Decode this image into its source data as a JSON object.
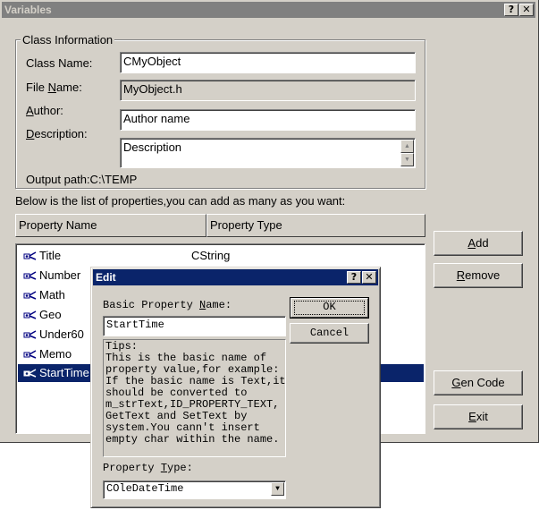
{
  "window": {
    "title": "Variables",
    "help_button": "?",
    "close_button": "✕"
  },
  "class_info": {
    "group_label": "Class Information",
    "class_name_label": "Class Name:",
    "class_name_value": "CMyObject",
    "file_name_label_pre": "File ",
    "file_name_label_u": "N",
    "file_name_label_post": "ame:",
    "file_name_value": "MyObject.h",
    "author_label_u": "A",
    "author_label_post": "uthor:",
    "author_value": "Author name",
    "description_label_u": "D",
    "description_label_post": "escription:",
    "description_value": "Description",
    "output_path": "Output path:C:\\TEMP"
  },
  "properties": {
    "intro": "Below is the list of properties,you can add as many as you want:",
    "col_name": "Property Name",
    "col_type": "Property Type",
    "rows": [
      {
        "name": "Title",
        "type": "CString"
      },
      {
        "name": "Number",
        "type": ""
      },
      {
        "name": "Math",
        "type": ""
      },
      {
        "name": "Geo",
        "type": ""
      },
      {
        "name": "Under60",
        "type": ""
      },
      {
        "name": "Memo",
        "type": ""
      },
      {
        "name": "StartTime",
        "type": ""
      }
    ]
  },
  "buttons": {
    "add_u": "A",
    "add_post": "dd",
    "remove_u": "R",
    "remove_post": "emove",
    "gencode_u": "G",
    "gencode_post": "en Code",
    "exit_u": "E",
    "exit_post": "xit"
  },
  "edit_dialog": {
    "title": "Edit",
    "help_button": "?",
    "close_button": "✕",
    "basic_name_label_pre": "Basic Property ",
    "basic_name_label_u": "N",
    "basic_name_label_post": "ame:",
    "basic_name_value": "StartTime",
    "tips": "Tips:\nThis is the basic name of\nproperty value,for example:\nIf the basic name is Text,it\nshould be converted to\nm_strText,ID_PROPERTY_TEXT,\nGetText and SetText by\nsystem.You cann't insert\nempty char within the name.",
    "type_label_pre": "Property ",
    "type_label_u": "T",
    "type_label_post": "ype:",
    "type_value": "COleDateTime",
    "ok": "OK",
    "cancel": "Cancel"
  },
  "colors": {
    "face": "#d4d0c8",
    "active_title": "#0a246a",
    "inactive_title": "#808080",
    "selection": "#0a246a"
  }
}
